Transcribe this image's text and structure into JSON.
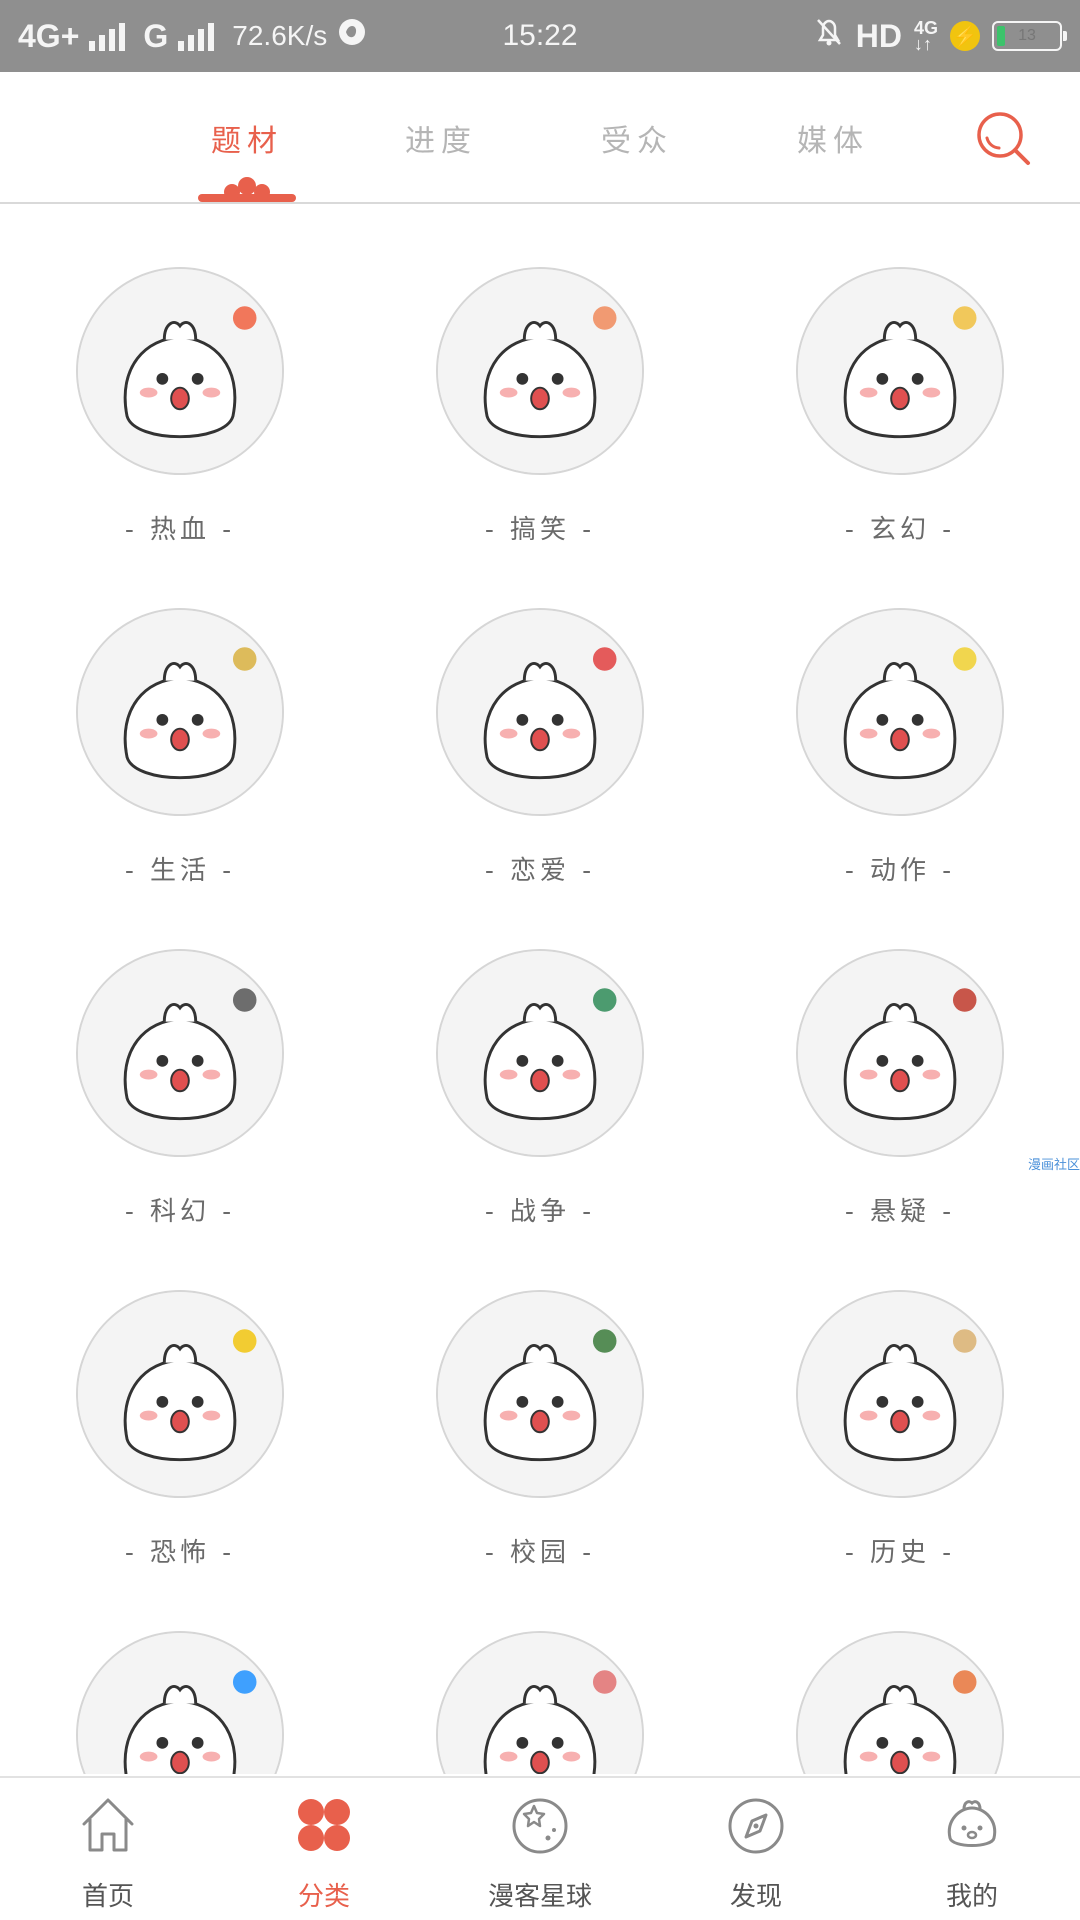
{
  "status": {
    "network": "4G+",
    "network2": "G",
    "speed": "72.6K/s",
    "time": "15:22",
    "hd": "HD",
    "net_type": "4G",
    "battery_level": "13",
    "battery_fraction": 0.13,
    "colors": {
      "bar_bg": "#8f8f8f",
      "battery_fill": "#3cc36b",
      "charging": "#f1c40f"
    }
  },
  "tabs": [
    {
      "label": "题材",
      "active": true
    },
    {
      "label": "进度",
      "active": false
    },
    {
      "label": "受众",
      "active": false
    },
    {
      "label": "媒体",
      "active": false
    }
  ],
  "search_icon": "search-icon",
  "accent_color": "#e8604c",
  "categories": [
    {
      "label": "- 热血 -",
      "icon": "hot-blood-bun"
    },
    {
      "label": "- 搞笑 -",
      "icon": "funny-bun"
    },
    {
      "label": "- 玄幻 -",
      "icon": "fantasy-bun"
    },
    {
      "label": "- 生活 -",
      "icon": "life-bun"
    },
    {
      "label": "- 恋爱 -",
      "icon": "romance-bun"
    },
    {
      "label": "- 动作 -",
      "icon": "action-bun"
    },
    {
      "label": "- 科幻 -",
      "icon": "scifi-ufo-bun"
    },
    {
      "label": "- 战争 -",
      "icon": "war-bun"
    },
    {
      "label": "- 悬疑 -",
      "icon": "mystery-bun"
    },
    {
      "label": "- 恐怖 -",
      "icon": "horror-skull-bun"
    },
    {
      "label": "- 校园 -",
      "icon": "campus-bun"
    },
    {
      "label": "- 历史 -",
      "icon": "history-bun"
    },
    {
      "label": "",
      "icon": "sports-bun"
    },
    {
      "label": "",
      "icon": "palace-bun"
    },
    {
      "label": "",
      "icon": "basketball-bun"
    }
  ],
  "watermark": "漫画社区",
  "nav": [
    {
      "label": "首页",
      "icon": "home-icon",
      "active": false
    },
    {
      "label": "分类",
      "icon": "category-icon",
      "active": true
    },
    {
      "label": "漫客星球",
      "icon": "planet-icon",
      "active": false
    },
    {
      "label": "发现",
      "icon": "compass-icon",
      "active": false
    },
    {
      "label": "我的",
      "icon": "profile-bun-icon",
      "active": false
    }
  ]
}
